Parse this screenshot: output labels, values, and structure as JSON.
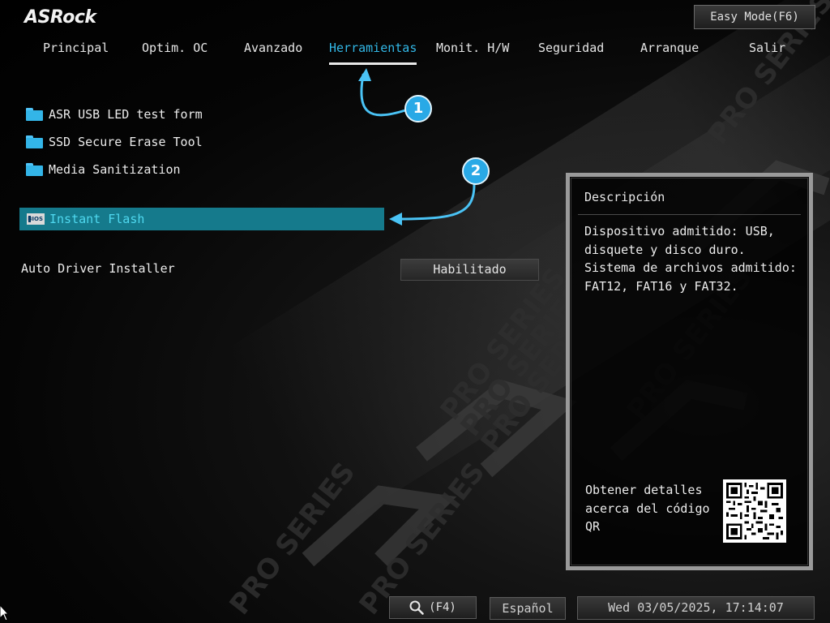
{
  "header": {
    "logo": "ASRock",
    "easy_mode_label": "Easy Mode(F6)"
  },
  "tabs": [
    {
      "label": "Principal",
      "active": false
    },
    {
      "label": "Optim. OC",
      "active": false
    },
    {
      "label": "Avanzado",
      "active": false
    },
    {
      "label": "Herramientas",
      "active": true
    },
    {
      "label": "Monit. H/W",
      "active": false
    },
    {
      "label": "Seguridad",
      "active": false
    },
    {
      "label": "Arranque",
      "active": false
    },
    {
      "label": "Salir",
      "active": false
    }
  ],
  "menu": {
    "items": [
      {
        "label": "ASR USB LED test form",
        "icon": "folder-icon"
      },
      {
        "label": "SSD Secure Erase Tool",
        "icon": "folder-icon"
      },
      {
        "label": "Media Sanitization",
        "icon": "folder-icon"
      }
    ],
    "selected": {
      "label": "Instant Flash",
      "icon": "bios-icon",
      "icon_text": "BIOS"
    },
    "settings": [
      {
        "label": "Auto Driver Installer",
        "value": "Habilitado"
      }
    ]
  },
  "description": {
    "title": "Descripción",
    "text": "Dispositivo admitido: USB, disquete y disco duro. Sistema de archivos admitido: FAT12, FAT16 y FAT32.",
    "qr_text": "Obtener detalles acerca del código QR"
  },
  "footer": {
    "search_label": "(F4)",
    "language": "Español",
    "datetime": "Wed 03/05/2025, 17:14:07"
  },
  "annotations": [
    {
      "number": "1"
    },
    {
      "number": "2"
    }
  ],
  "colors": {
    "accent": "#32b7e6",
    "selected_bg": "#157a8c",
    "callout": "#29a9e6"
  }
}
